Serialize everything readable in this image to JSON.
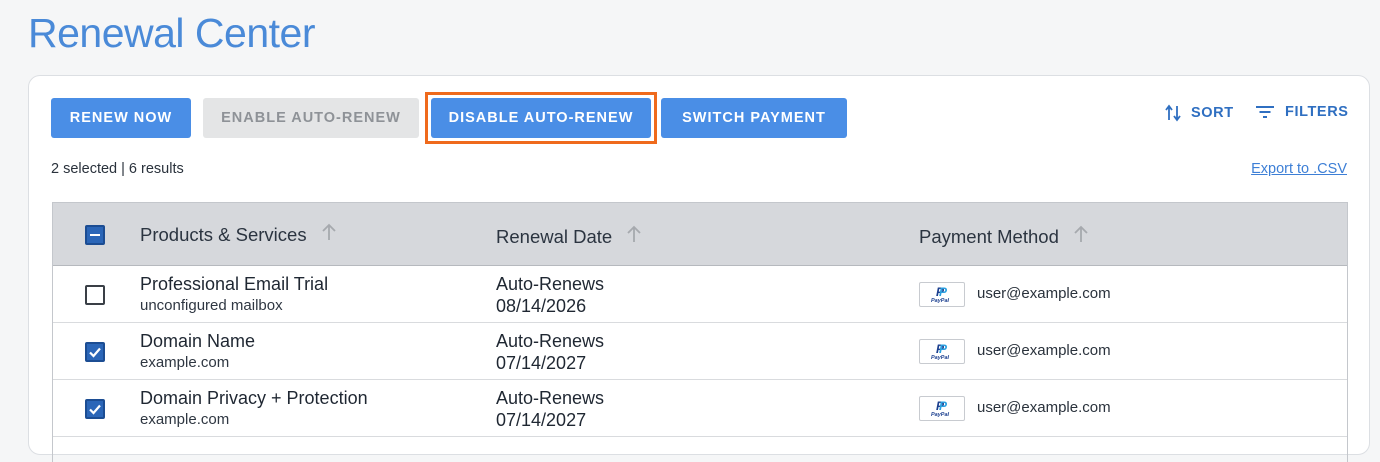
{
  "page": {
    "title": "Renewal Center"
  },
  "toolbar": {
    "renew_now": "RENEW NOW",
    "enable_auto_renew": "ENABLE AUTO-RENEW",
    "disable_auto_renew": "DISABLE AUTO-RENEW",
    "switch_payment": "SWITCH PAYMENT",
    "sort": "SORT",
    "filters": "FILTERS"
  },
  "status": {
    "summary": "2 selected | 6 results",
    "export_link": "Export to .CSV"
  },
  "table": {
    "headers": {
      "products": "Products & Services",
      "renewal_date": "Renewal Date",
      "payment_method": "Payment Method"
    },
    "rows": [
      {
        "selected": false,
        "name": "Professional Email Trial",
        "sub": "unconfigured mailbox",
        "renewal_type": "Auto-Renews",
        "renewal_date": "08/14/2026",
        "payment_icon": "paypal-logo",
        "payment_email": "user@example.com"
      },
      {
        "selected": true,
        "name": "Domain Name",
        "sub": "example.com",
        "renewal_type": "Auto-Renews",
        "renewal_date": "07/14/2027",
        "payment_icon": "paypal-logo",
        "payment_email": "user@example.com"
      },
      {
        "selected": true,
        "name": "Domain Privacy + Protection",
        "sub": "example.com",
        "renewal_type": "Auto-Renews",
        "renewal_date": "07/14/2027",
        "payment_icon": "paypal-logo",
        "payment_email": "user@example.com"
      }
    ]
  },
  "icons": {
    "paypal_mark": "P",
    "paypal_wordmark": "PayPal"
  },
  "colors": {
    "accent": "#4a8ee6",
    "title": "#4a8ad8",
    "highlight": "#ef6a1c",
    "link": "#3d7fd6"
  }
}
